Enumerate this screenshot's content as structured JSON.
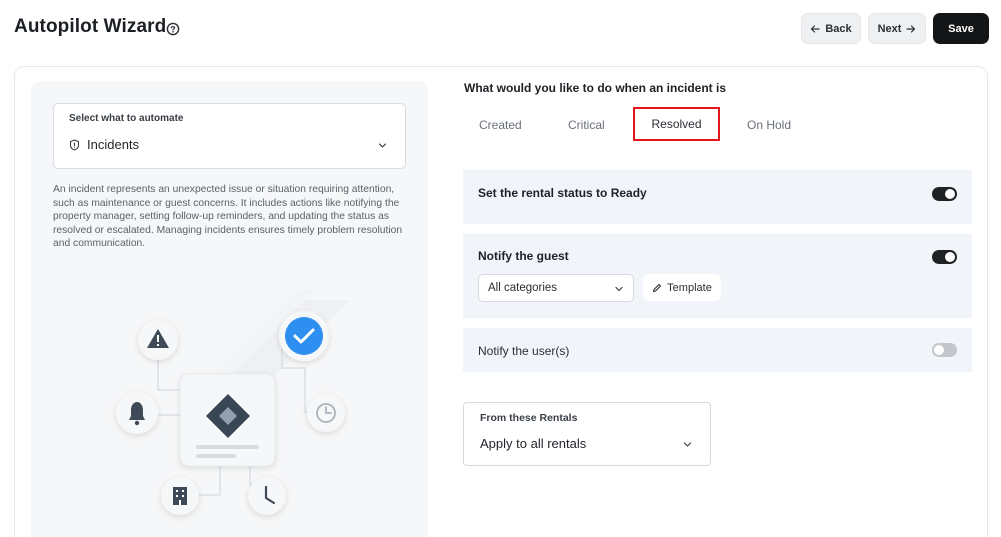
{
  "header": {
    "title": "Autopilot Wizard",
    "back_label": "Back",
    "next_label": "Next",
    "save_label": "Save"
  },
  "left": {
    "select_label": "Select what to automate",
    "select_value": "Incidents",
    "description": "An incident represents an unexpected issue or situation requiring attention, such as maintenance or guest concerns. It includes actions like notifying the property manager, setting follow-up reminders, and updating the status as resolved or escalated. Managing incidents ensures timely problem resolution and communication."
  },
  "right": {
    "question": "What would you like to do when an incident is",
    "tabs": [
      {
        "label": "Created",
        "selected": false
      },
      {
        "label": "Critical",
        "selected": false
      },
      {
        "label": "Resolved",
        "selected": true
      },
      {
        "label": "On Hold",
        "selected": false
      }
    ],
    "actions": [
      {
        "title": "Set the rental status to Ready",
        "enabled": true
      },
      {
        "title": "Notify the guest",
        "enabled": true,
        "category_value": "All categories",
        "template_label": "Template"
      },
      {
        "title": "Notify the user(s)",
        "enabled": false
      }
    ],
    "rentals": {
      "label": "From these Rentals",
      "value": "Apply to all rentals"
    }
  },
  "colors": {
    "primary_dark": "#141517",
    "highlight": "#e1141b",
    "check_blue": "#2f8ff0",
    "row_bg": "#f1f4f9"
  },
  "icons": [
    "help-circle-icon",
    "arrow-left-icon",
    "arrow-right-icon",
    "shield-icon",
    "chevron-down-icon",
    "pencil-icon",
    "warning-icon",
    "checkmark-icon",
    "bell-icon",
    "clock-icon",
    "building-icon",
    "diamond-icon"
  ]
}
